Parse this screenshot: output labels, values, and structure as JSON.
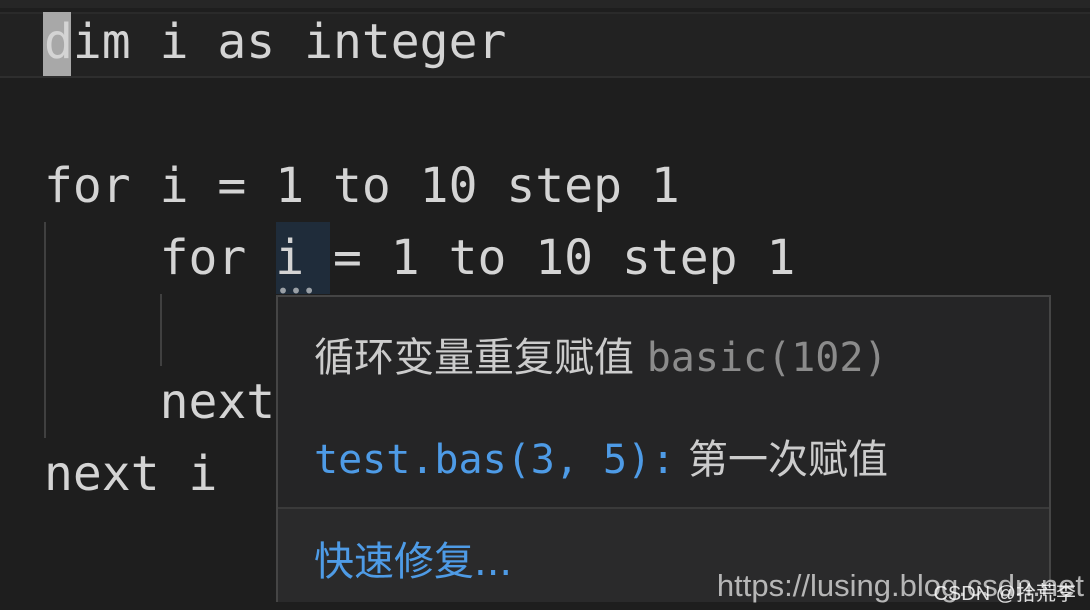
{
  "editor": {
    "lines": [
      "dim i as integer",
      "",
      "for i = 1 to 10 step 1",
      "    for i = 1 to 10 step 1",
      "",
      "    next",
      "next i"
    ]
  },
  "hover": {
    "message": "循环变量重复赋值",
    "code": "basic(102)",
    "related_location": "test.bas(3, 5):",
    "related_message": "第一次赋值",
    "quick_fix": "快速修复..."
  },
  "watermark": {
    "url": "https://lusing.blog.csdn.net",
    "author": "CSDN @拾荒李"
  },
  "colors": {
    "background": "#1e1e1e",
    "hover_bg": "#252526",
    "link": "#4e9be6"
  }
}
